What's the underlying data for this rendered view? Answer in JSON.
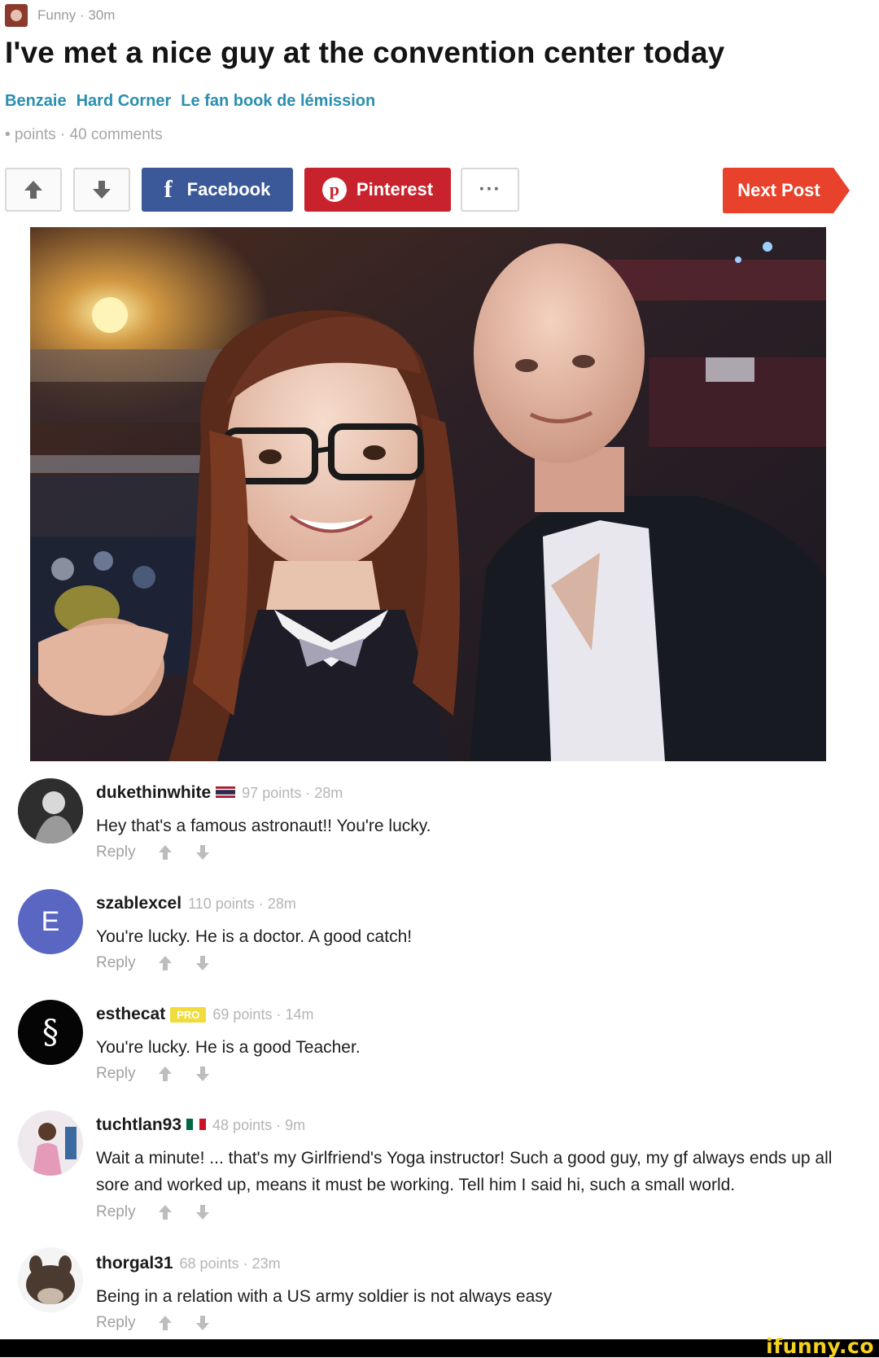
{
  "post": {
    "section_label": "Funny · 30m",
    "title": "I've met a nice guy at the convention center today",
    "tags": [
      "Benzaie",
      "Hard Corner",
      "Le fan book de lémission"
    ],
    "meta": "• points · 40 comments"
  },
  "actions": {
    "facebook_label": "Facebook",
    "pinterest_label": "Pinterest",
    "more_label": "···",
    "next_label": "Next Post"
  },
  "comments": [
    {
      "user": "dukethinwhite",
      "meta": "97 points · 28m",
      "text": "Hey that's a famous astronaut!! You're lucky.",
      "reply": "Reply"
    },
    {
      "user": "szablexcel",
      "avatar_letter": "E",
      "meta": "110 points · 28m",
      "text": "You're lucky. He is a doctor. A good catch!",
      "reply": "Reply"
    },
    {
      "user": "esthecat",
      "badge": "PRO",
      "meta": "69 points · 14m",
      "text": "You're lucky. He is a good Teacher.",
      "reply": "Reply"
    },
    {
      "user": "tuchtlan93",
      "meta": "48 points · 9m",
      "text": "Wait a minute! ... that's my Girlfriend's Yoga instructor! Such a good guy, my gf always ends up all sore and worked up, means it must be working. Tell him I said hi, such a small world.",
      "reply": "Reply"
    },
    {
      "user": "thorgal31",
      "meta": "68 points · 23m",
      "text": "Being in a relation with a US army soldier is not always easy",
      "reply": "Reply"
    }
  ],
  "watermark": "ifunny.co",
  "colors": {
    "facebook": "#3b5998",
    "pinterest": "#c8232c",
    "next_post": "#e8412c",
    "tag_link": "#2a8fb0",
    "pro_badge": "#f2dc3c"
  }
}
